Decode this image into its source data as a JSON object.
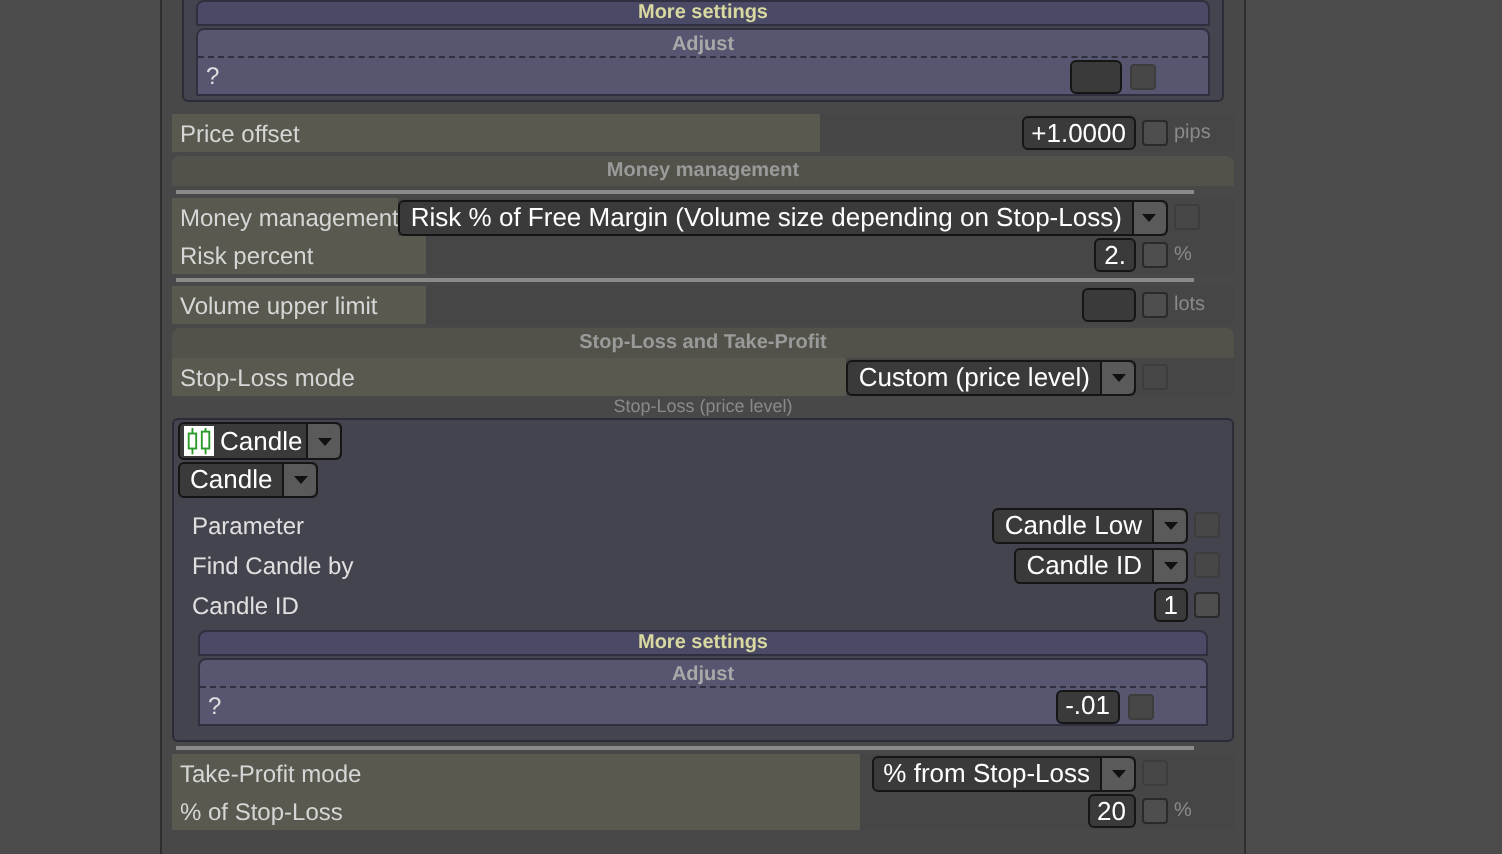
{
  "top_adjust": {
    "title": "More settings",
    "subtitle": "Adjust",
    "label": "?",
    "checked": false
  },
  "rows": [
    {
      "kind": "input",
      "label": "Price offset",
      "value": "+1.0000",
      "unit": "pips",
      "checked": false
    },
    {
      "kind": "header",
      "title": "Money management"
    },
    {
      "kind": "divider"
    },
    {
      "kind": "dropdown",
      "label": "Money management",
      "value": "Risk % of Free Margin (Volume size depending on Stop-Loss)",
      "checked": false
    },
    {
      "kind": "input",
      "label": "Risk percent",
      "value": "2.",
      "unit": "%",
      "checked": false
    },
    {
      "kind": "divider"
    },
    {
      "kind": "input",
      "label": "Volume upper limit",
      "unit": "lots",
      "checked": false
    },
    {
      "kind": "header",
      "title": "Stop-Loss and Take-Profit"
    },
    {
      "kind": "dropdown",
      "label": "Stop-Loss mode",
      "value": "Custom (price level)",
      "checked": false
    },
    {
      "kind": "caption",
      "text": "Stop-Loss (price level)"
    },
    {
      "kind": "group",
      "source": "Candle",
      "type": "Candle",
      "fields": [
        {
          "kind": "dropdown",
          "label": "Parameter",
          "value": "Candle Low",
          "checked": false
        },
        {
          "kind": "dropdown",
          "label": "Find Candle by",
          "value": "Candle ID",
          "checked": false
        },
        {
          "kind": "input",
          "label": "Candle ID",
          "value": "1",
          "checked": false
        }
      ],
      "more": {
        "title": "More settings",
        "subtitle": "Adjust",
        "label": "?",
        "value": "-.01",
        "checked": false
      }
    },
    {
      "kind": "divider"
    },
    {
      "kind": "dropdown",
      "label": "Take-Profit mode",
      "value": "% from Stop-Loss",
      "checked": false
    },
    {
      "kind": "input",
      "label": "% of Stop-Loss",
      "value": "20",
      "unit": "%",
      "checked": false
    }
  ]
}
